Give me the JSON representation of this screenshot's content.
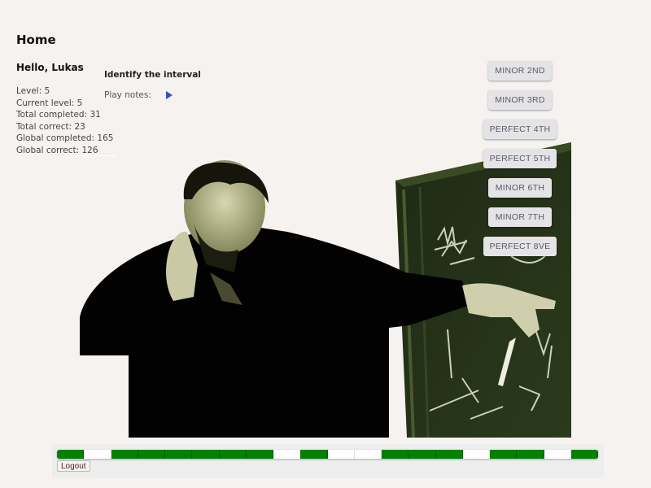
{
  "header": {
    "title": "Home"
  },
  "user": {
    "greeting": "Hello, Lukas",
    "stats": [
      "Level: 5",
      "Current level: 5",
      "Total completed: 31",
      "Total correct: 23",
      "Global completed: 165",
      "Global correct: 126"
    ]
  },
  "exercise": {
    "title": "Identify the interval",
    "play_label": "Play notes:",
    "play_icon": "play-triangle-icon"
  },
  "answers": [
    {
      "label": "MINOR 2ND"
    },
    {
      "label": "MINOR 3RD"
    },
    {
      "label": "PERFECT 4TH"
    },
    {
      "label": "PERFECT 5TH"
    },
    {
      "label": "MINOR 6TH"
    },
    {
      "label": "MINOR 7TH"
    },
    {
      "label": "PERFECT 8VE"
    }
  ],
  "progress": {
    "results": [
      1,
      0,
      1,
      1,
      1,
      1,
      1,
      1,
      0,
      1,
      0,
      0,
      1,
      1,
      1,
      0,
      1,
      1,
      0,
      1
    ],
    "correct_color": "#018001",
    "incorrect_color": "#ffffff"
  },
  "footer": {
    "logout_label": "Logout"
  },
  "colors": {
    "accent": "#3b4bbf",
    "background": "#f5f2ef"
  }
}
